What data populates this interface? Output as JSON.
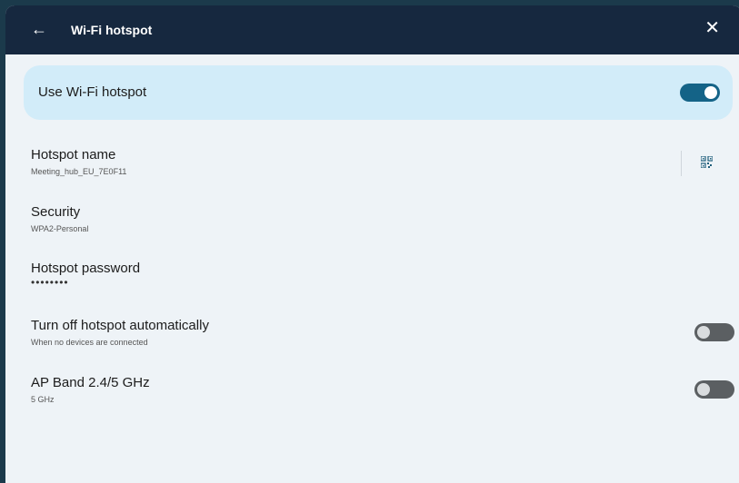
{
  "topbar": {
    "back_icon": "arrow-left-icon",
    "title": "Wi-Fi hotspot",
    "close_icon": "close-icon"
  },
  "master": {
    "label": "Use Wi-Fi hotspot",
    "enabled": true
  },
  "settings": {
    "name": {
      "title": "Hotspot name",
      "value": "Meeting_hub_EU_7E0F11",
      "action_icon": "qr-code-icon"
    },
    "security": {
      "title": "Security",
      "value": "WPA2-Personal"
    },
    "password": {
      "title": "Hotspot password",
      "masked_value": "••••••••"
    },
    "auto_off": {
      "title": "Turn off hotspot automatically",
      "subtitle": "When no devices are connected",
      "enabled": false
    },
    "ap_band": {
      "title": "AP Band 2.4/5 GHz",
      "subtitle": "5 GHz",
      "enabled": false
    }
  },
  "colors": {
    "topbar": "#16283f",
    "page_background": "#eef3f7",
    "master_card": "#d2ecf9",
    "toggle_on": "#146387",
    "toggle_off": "#5b5f62"
  }
}
